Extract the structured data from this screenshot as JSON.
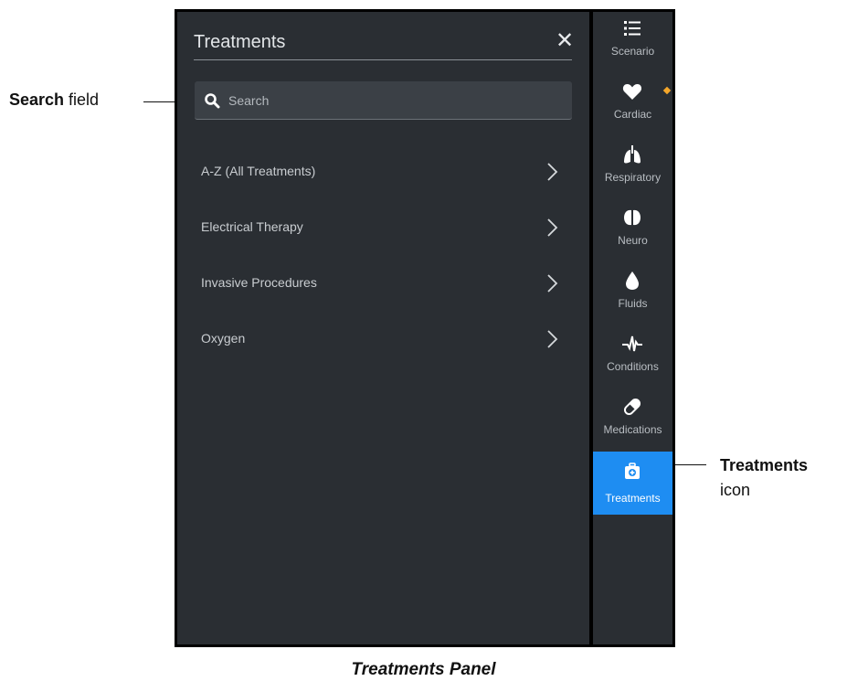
{
  "panel": {
    "title": "Treatments",
    "close_glyph": "✕",
    "search": {
      "placeholder": "Search",
      "value": ""
    },
    "items": [
      {
        "label": "A-Z (All Treatments)"
      },
      {
        "label": "Electrical Therapy"
      },
      {
        "label": "Invasive Procedures"
      },
      {
        "label": "Oxygen"
      }
    ]
  },
  "rail": {
    "items": [
      {
        "label": "Scenario",
        "icon": "list-icon"
      },
      {
        "label": "Cardiac",
        "icon": "heart-icon",
        "badge": true
      },
      {
        "label": "Respiratory",
        "icon": "lungs-icon"
      },
      {
        "label": "Neuro",
        "icon": "brain-icon"
      },
      {
        "label": "Fluids",
        "icon": "droplet-icon"
      },
      {
        "label": "Conditions",
        "icon": "pulse-icon"
      },
      {
        "label": "Medications",
        "icon": "pill-icon"
      },
      {
        "label": "Treatments",
        "icon": "medkit-icon",
        "active": true
      }
    ]
  },
  "callouts": {
    "search_bold": "Search",
    "search_rest": " field",
    "treat_bold": "Treatments",
    "treat_rest": "icon"
  },
  "caption": "Treatments Panel",
  "colors": {
    "panel_bg": "#2a2e33",
    "accent": "#1e8df2",
    "badge": "#f4a62a"
  }
}
